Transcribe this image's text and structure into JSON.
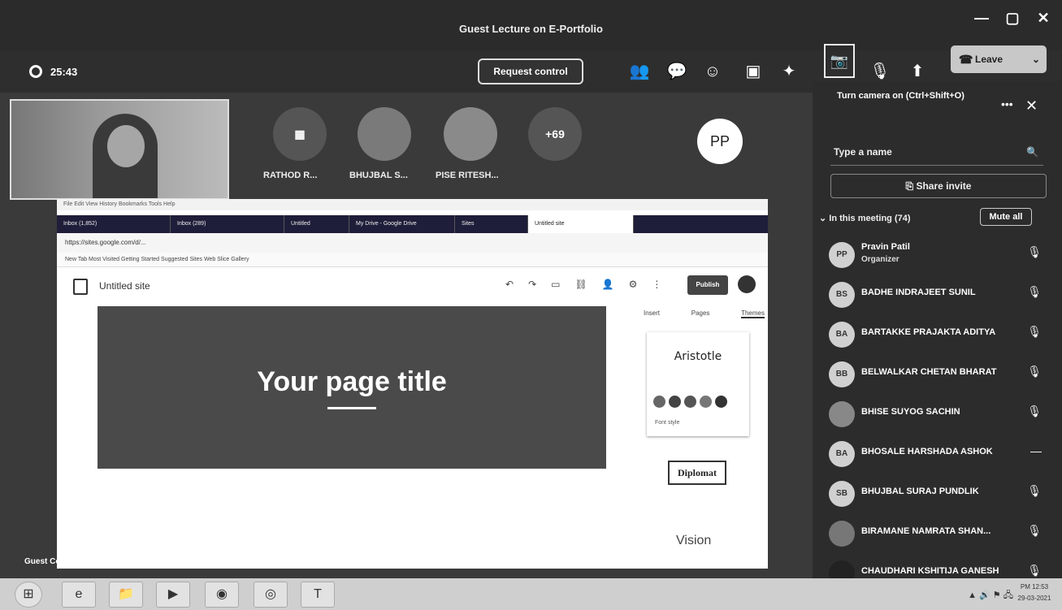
{
  "window": {
    "title": "Guest Lecture on E-Portfolio",
    "controls": [
      "—",
      "▢",
      "✕"
    ]
  },
  "toolbar": {
    "timer": "25:43",
    "request_control": "Request control",
    "leave": "Leave"
  },
  "participants_strip": [
    {
      "name": "RATHOD R...",
      "initials": "▦"
    },
    {
      "name": "BHUJBAL S...",
      "initials": ""
    },
    {
      "name": "PISE RITESH...",
      "initials": ""
    },
    {
      "name": "",
      "initials": "+69"
    }
  ],
  "pp_avatar": "PP",
  "panel": {
    "tooltip": "Turn camera on (Ctrl+Shift+O)",
    "search_placeholder": "Type a name",
    "share_invite": "Share invite",
    "in_meeting": "In this meeting (74)",
    "mute_all": "Mute all",
    "people": [
      {
        "initials": "PP",
        "name": "Pravin Patil",
        "role": "Organizer"
      },
      {
        "initials": "BS",
        "name": "BADHE INDRAJEET SUNIL",
        "role": ""
      },
      {
        "initials": "BA",
        "name": "BARTAKKE PRAJAKTA ADITYA",
        "role": ""
      },
      {
        "initials": "BB",
        "name": "BELWALKAR CHETAN BHARAT",
        "role": ""
      },
      {
        "initials": "",
        "name": "BHISE SUYOG SACHIN",
        "role": ""
      },
      {
        "initials": "BA",
        "name": "BHOSALE HARSHADA ASHOK",
        "role": ""
      },
      {
        "initials": "SB",
        "name": "BHUJBAL SURAJ PUNDLIK",
        "role": ""
      },
      {
        "initials": "",
        "name": "BIRAMANE NAMRATA SHAN...",
        "role": ""
      },
      {
        "initials": "",
        "name": "CHAUDHARI KSHITIJA GANESH",
        "role": ""
      }
    ]
  },
  "shared_screen": {
    "menubar": "File  Edit  View  History  Bookmarks  Tools  Help",
    "tabs": [
      "Inbox (1,852)",
      "Inbox (289)",
      "Untitled",
      "My Drive - Google Drive",
      "Sites",
      "Untitled site"
    ],
    "address": "https://sites.google.com/d/...",
    "bookmarks": "New Tab   Most Visited   Getting Started   Suggested Sites   Web Slice Gallery",
    "site_title": "Untitled site",
    "publish": "Publish",
    "hero_title": "Your page title",
    "side_tabs": [
      "Insert",
      "Pages",
      "Themes"
    ],
    "theme_name": "Aristotle",
    "font_style": "Font style",
    "theme2": "Diplomat",
    "theme3": "Vision"
  },
  "guest_label": "Guest Computer",
  "taskbar": {
    "clock_time": "PM 12:53",
    "clock_date": "29-03-2021"
  }
}
